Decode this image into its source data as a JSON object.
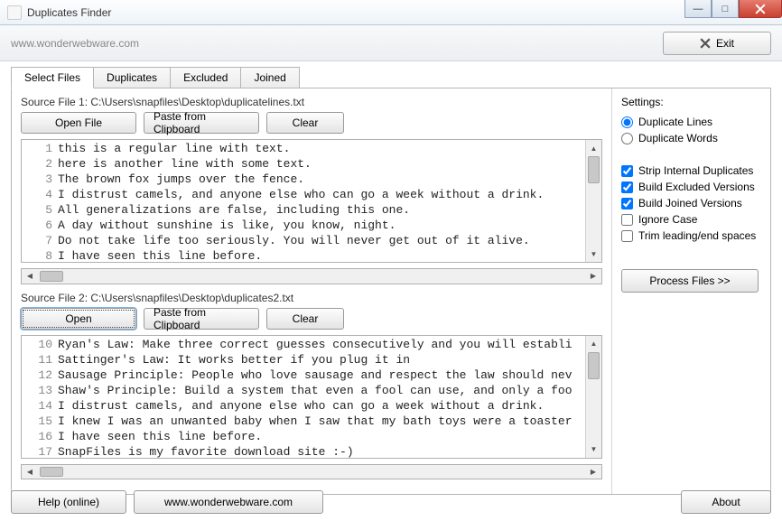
{
  "window": {
    "title": "Duplicates Finder"
  },
  "toolbar": {
    "url": "www.wonderwebware.com",
    "exit_label": "Exit"
  },
  "tabs": {
    "select_files": "Select Files",
    "duplicates": "Duplicates",
    "excluded": "Excluded",
    "joined": "Joined"
  },
  "source1": {
    "label": "Source File 1: C:\\Users\\snapfiles\\Desktop\\duplicatelines.txt",
    "open_btn": "Open File",
    "paste_btn": "Paste from Clipboard",
    "clear_btn": "Clear",
    "lines": [
      {
        "n": "1",
        "t": "this is a regular line with text."
      },
      {
        "n": "2",
        "t": "here is another line with some text."
      },
      {
        "n": "3",
        "t": "The brown fox jumps over the fence."
      },
      {
        "n": "4",
        "t": "I distrust camels, and anyone else who can go a week without a drink."
      },
      {
        "n": "5",
        "t": "All generalizations are false, including this one."
      },
      {
        "n": "6",
        "t": "A day without sunshine is like, you know, night."
      },
      {
        "n": "7",
        "t": "Do not take life too seriously. You will never get out of it alive."
      },
      {
        "n": "8",
        "t": "I have seen this line before."
      }
    ]
  },
  "source2": {
    "label": "Source File 2: C:\\Users\\snapfiles\\Desktop\\duplicates2.txt",
    "open_btn": "Open",
    "paste_btn": "Paste from Clipboard",
    "clear_btn": "Clear",
    "lines": [
      {
        "n": "10",
        "t": "Ryan's Law: Make three correct guesses consecutively and you will establi"
      },
      {
        "n": "11",
        "t": "Sattinger's Law: It works better if you plug it in"
      },
      {
        "n": "12",
        "t": "Sausage Principle: People who love sausage and respect the law should nev"
      },
      {
        "n": "13",
        "t": "Shaw's Principle: Build a system that even a fool can use, and only a foo"
      },
      {
        "n": "14",
        "t": "I distrust camels, and anyone else who can go a week without a drink."
      },
      {
        "n": "15",
        "t": "I knew I was an unwanted baby when I saw that my bath toys were a toaster"
      },
      {
        "n": "16",
        "t": "I have seen this line before."
      },
      {
        "n": "17",
        "t": "SnapFiles is my favorite download site :-)"
      }
    ]
  },
  "settings": {
    "title": "Settings:",
    "radio_lines": "Duplicate Lines",
    "radio_words": "Duplicate Words",
    "chk_strip": "Strip Internal Duplicates",
    "chk_excluded": "Build Excluded Versions",
    "chk_joined": "Build Joined Versions",
    "chk_ignorecase": "Ignore Case",
    "chk_trim": "Trim leading/end spaces",
    "process_btn": "Process Files  >>"
  },
  "footer": {
    "help_btn": "Help (online)",
    "site_btn": "www.wonderwebware.com",
    "about_btn": "About"
  }
}
